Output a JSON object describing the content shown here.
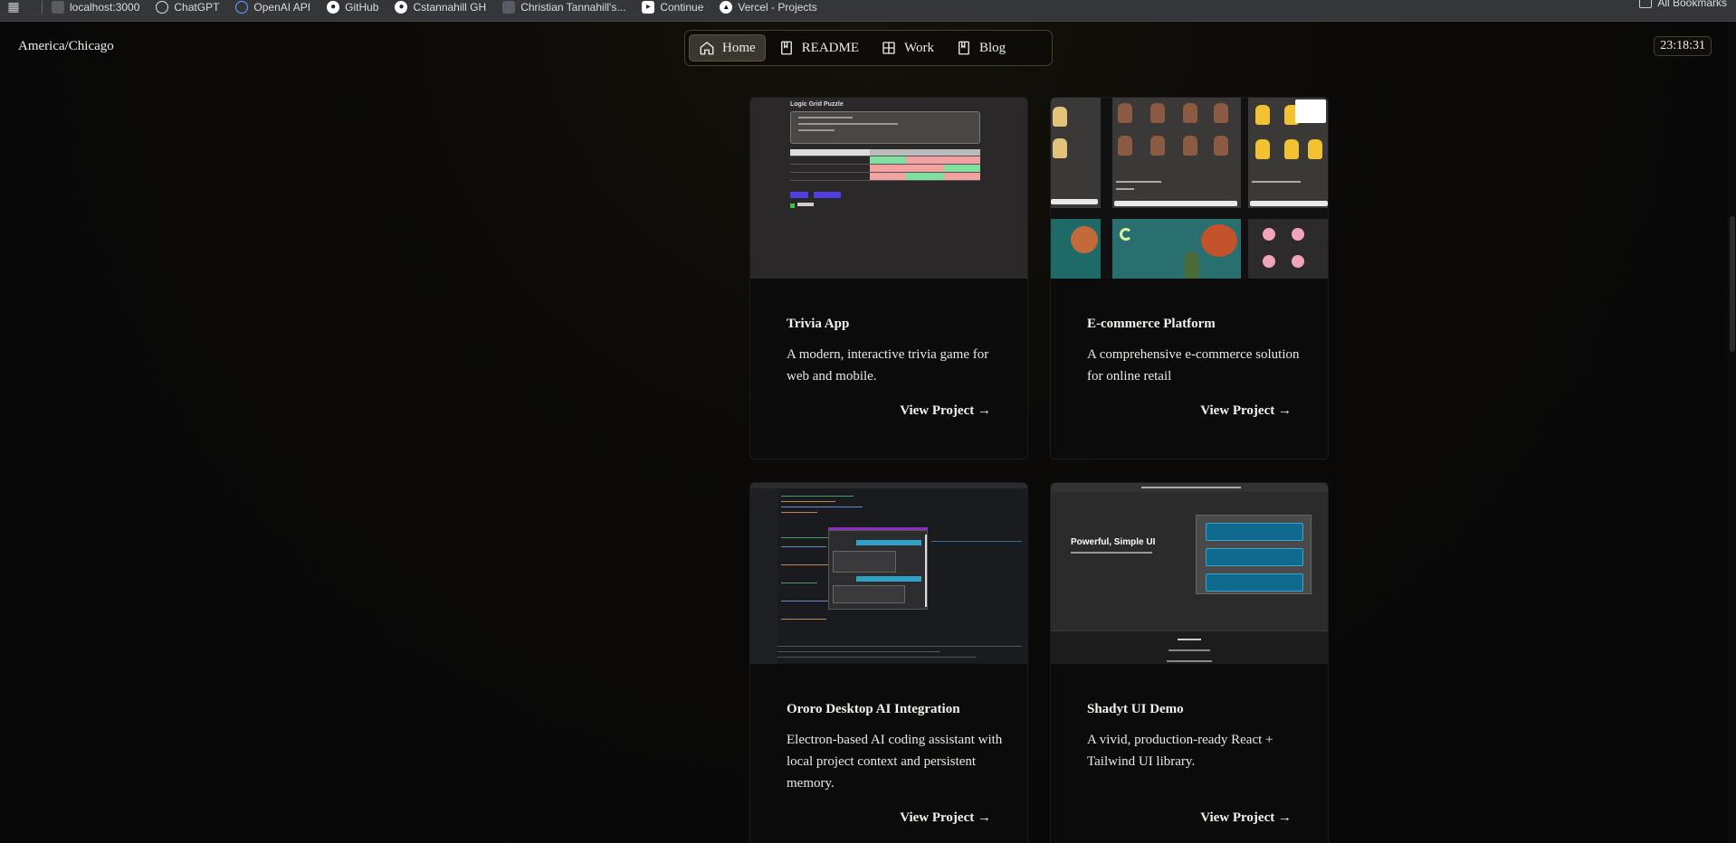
{
  "bookmarks": {
    "items": [
      {
        "label": "localhost:3000",
        "icon": "page-icon"
      },
      {
        "label": "ChatGPT",
        "icon": "chatgpt-icon"
      },
      {
        "label": "OpenAI API",
        "icon": "openai-icon"
      },
      {
        "label": "GitHub",
        "icon": "github-icon"
      },
      {
        "label": "Cstannahill GH",
        "icon": "github-icon"
      },
      {
        "label": "Christian Tannahill's...",
        "icon": "page-icon"
      },
      {
        "label": "Continue",
        "icon": "continue-icon"
      },
      {
        "label": "Vercel - Projects",
        "icon": "vercel-icon"
      }
    ],
    "all_bookmarks": "All Bookmarks"
  },
  "header": {
    "timezone": "America/Chicago",
    "clock": "23:18:31"
  },
  "nav": {
    "items": [
      {
        "label": "Home",
        "icon": "home-icon",
        "active": true
      },
      {
        "label": "README",
        "icon": "book-icon",
        "active": false
      },
      {
        "label": "Work",
        "icon": "grid-icon",
        "active": false
      },
      {
        "label": "Blog",
        "icon": "book-icon",
        "active": false
      }
    ]
  },
  "projects": [
    {
      "title": "Trivia App",
      "description": "A modern, interactive trivia game for web and mobile.",
      "link": "View Project →",
      "thumb_title": "Logic Grid Puzzle"
    },
    {
      "title": "E-commerce Platform",
      "description": "A comprehensive e-commerce solution for online retail",
      "link": "View Project →"
    },
    {
      "title": "Ororo Desktop AI Integration",
      "description": "Electron-based AI coding assistant with local project context and persistent memory.",
      "link": "View Project →"
    },
    {
      "title": "Shadyt UI Demo",
      "description": "A vivid, production-ready React + Tailwind UI library.",
      "link": "View Project →",
      "thumb_title": "Powerful, Simple UI"
    }
  ],
  "colors": {
    "background": "#0a0908",
    "nav_border": "#4b412a",
    "active_nav": "#3a372f"
  }
}
